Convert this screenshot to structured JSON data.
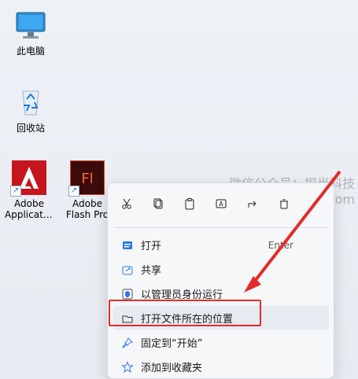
{
  "desktop": {
    "icons": [
      {
        "name": "this-pc",
        "label": "此电脑"
      },
      {
        "name": "recycle-bin",
        "label": "回收站"
      },
      {
        "name": "adobe-application",
        "label_line1": "Adobe",
        "label_line2": "Applicati..."
      },
      {
        "name": "adobe-flash",
        "label_line1": "Adobe",
        "label_line2": "Flash Pro"
      }
    ]
  },
  "watermark": {
    "line1": "微信公众号：探尚科技",
    "line2": "官网：tankj.com"
  },
  "context_menu": {
    "toolbar_icons": [
      "cut-icon",
      "copy-icon",
      "paste-icon",
      "rename-icon",
      "share-icon",
      "delete-icon"
    ],
    "items": [
      {
        "label": "打开",
        "shortcut": "Enter",
        "icon": "open-icon"
      },
      {
        "label": "共享",
        "icon": "share-icon"
      },
      {
        "label": "以管理员身份运行",
        "icon": "shield-icon"
      },
      {
        "label": "打开文件所在的位置",
        "icon": "folder-icon"
      },
      {
        "label": "固定到“开始”",
        "icon": "pin-icon"
      },
      {
        "label": "添加到收藏夹",
        "icon": "star-icon"
      }
    ]
  },
  "colors": {
    "highlight_red": "#e42b2b",
    "menu_bg": "#f6f7f9"
  }
}
